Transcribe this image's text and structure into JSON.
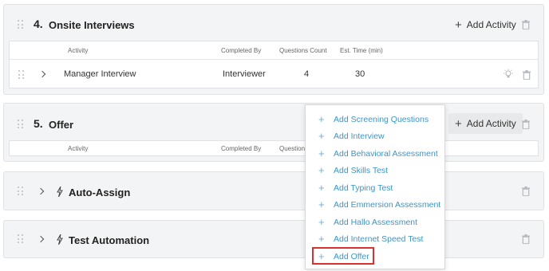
{
  "columns": {
    "activity": "Activity",
    "completed_by": "Completed By",
    "questions_count": "Questions Count",
    "questions_count_truncated": "Question",
    "est_time": "Est. Time (min)"
  },
  "sections": {
    "onsite": {
      "number": "4.",
      "title": "Onsite Interviews",
      "add_activity": "Add Activity",
      "row": {
        "activity": "Manager Interview",
        "completed_by": "Interviewer",
        "questions_count": "4",
        "est_time": "30"
      }
    },
    "offer": {
      "number": "5.",
      "title": "Offer",
      "add_activity": "Add Activity"
    },
    "auto_assign": {
      "title": "Auto-Assign"
    },
    "test_automation": {
      "title": "Test Automation"
    }
  },
  "dropdown": {
    "items": [
      {
        "label": "Add Screening Questions"
      },
      {
        "label": "Add Interview"
      },
      {
        "label": "Add Behavioral Assessment"
      },
      {
        "label": "Add Skills Test"
      },
      {
        "label": "Add Typing Test"
      },
      {
        "label": "Add Emmersion Assessment"
      },
      {
        "label": "Add Hallo Assessment"
      },
      {
        "label": "Add Internet Speed Test"
      },
      {
        "label": "Add Offer"
      }
    ],
    "highlighted_item": "Add Offer"
  },
  "colors": {
    "link": "#3b95c9",
    "highlight_border": "#d93030",
    "section_bg": "#f3f4f5"
  },
  "icons": {
    "drag": "drag-handle-icon",
    "trash": "trash-icon",
    "chevron": "chevron-right-icon",
    "bolt": "lightning-bolt-icon",
    "bulb": "lightbulb-icon",
    "plus": "plus-icon"
  }
}
